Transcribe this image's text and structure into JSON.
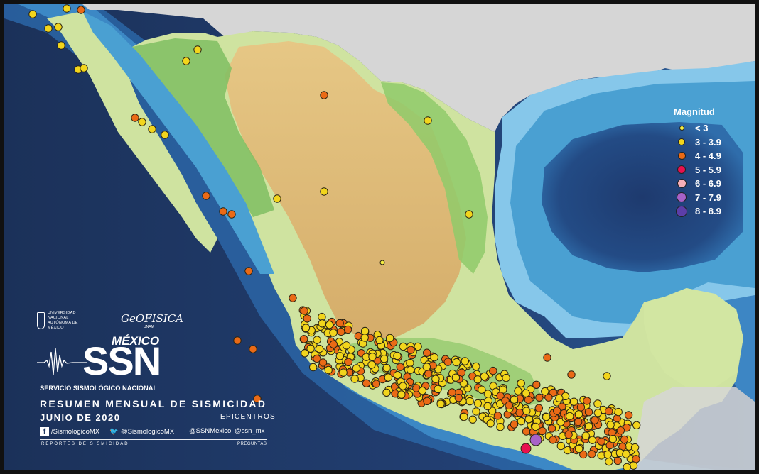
{
  "legend": {
    "title": "Magnitud",
    "items": [
      {
        "label": "< 3",
        "color": "#f5ee40"
      },
      {
        "label": "3 - 3.9",
        "color": "#f2d51c"
      },
      {
        "label": "4 - 4.9",
        "color": "#ea6a16"
      },
      {
        "label": "5 - 5.9",
        "color": "#e8104f"
      },
      {
        "label": "6 - 6.9",
        "color": "#f6aeb8"
      },
      {
        "label": "7 - 7.9",
        "color": "#a862c8"
      },
      {
        "label": "8 - 8.9",
        "color": "#5c3ea8"
      }
    ]
  },
  "branding": {
    "unam_line1": "UNIVERSIDAD NACIONAL",
    "unam_line2": "AUTÓNOMA DE MÉXICO",
    "geofisica": "GeOFISICA",
    "geofisica_sub": "UNAM",
    "mexico": "MÉXICO",
    "ssn": "SSN",
    "ssn_full": "SERVICIO SISMOLÓGICO NACIONAL"
  },
  "report": {
    "title": "RESUMEN MENSUAL DE SISMICIDAD",
    "month": "JUNIO DE 2020",
    "subtitle": "EPICENTROS",
    "facebook": "/SismologicoMX",
    "twitter1": "@SismologicoMX",
    "twitter2": "@SSNMexico",
    "web": "@ssn_mx",
    "footer_left": "REPORTES DE SISMICIDAD",
    "footer_right": "PREGUNTAS"
  },
  "colors": {
    "deep_ocean": "#1d3560",
    "mid_ocean": "#2c68a8",
    "shallow_ocean": "#4aa0d2",
    "shelf": "#86c7ea",
    "land_low": "#cfe3a0",
    "land_green": "#7fbe62",
    "land_high": "#d9b06e",
    "usa_grey": "#d6d6d6"
  }
}
